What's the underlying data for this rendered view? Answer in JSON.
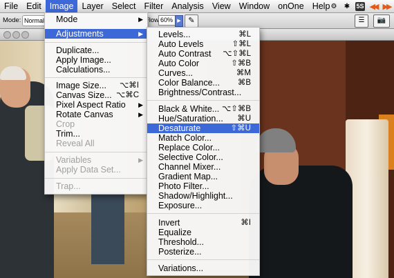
{
  "menubar": {
    "items": [
      "File",
      "Edit",
      "Image",
      "Layer",
      "Select",
      "Filter",
      "Analysis",
      "View",
      "Window",
      "onOne",
      "Help"
    ],
    "active_index": 2,
    "status": {
      "cs_badge": "5S"
    }
  },
  "options_bar": {
    "mode_label": "Mode:",
    "mode_value": "Normal",
    "flow_label": "Flow:",
    "flow_value": "60%"
  },
  "image_menu": {
    "items": [
      {
        "label": "Mode",
        "submenu": true
      },
      {
        "label": "Adjustments",
        "submenu": true,
        "highlight": true
      },
      {
        "label": "Duplicate..."
      },
      {
        "label": "Apply Image..."
      },
      {
        "label": "Calculations..."
      },
      {
        "label": "Image Size...",
        "shortcut": "⌥⌘I"
      },
      {
        "label": "Canvas Size...",
        "shortcut": "⌥⌘C"
      },
      {
        "label": "Pixel Aspect Ratio",
        "submenu": true
      },
      {
        "label": "Rotate Canvas",
        "submenu": true
      },
      {
        "label": "Crop",
        "disabled": true
      },
      {
        "label": "Trim..."
      },
      {
        "label": "Reveal All",
        "disabled": true
      },
      {
        "label": "Variables",
        "submenu": true,
        "disabled": true
      },
      {
        "label": "Apply Data Set...",
        "disabled": true
      },
      {
        "label": "Trap...",
        "disabled": true
      }
    ]
  },
  "adjustments_menu": {
    "items": [
      {
        "label": "Levels...",
        "shortcut": "⌘L"
      },
      {
        "label": "Auto Levels",
        "shortcut": "⇧⌘L"
      },
      {
        "label": "Auto Contrast",
        "shortcut": "⌥⇧⌘L"
      },
      {
        "label": "Auto Color",
        "shortcut": "⇧⌘B"
      },
      {
        "label": "Curves...",
        "shortcut": "⌘M"
      },
      {
        "label": "Color Balance...",
        "shortcut": "⌘B"
      },
      {
        "label": "Brightness/Contrast..."
      },
      {
        "label": "Black & White...",
        "shortcut": "⌥⇧⌘B"
      },
      {
        "label": "Hue/Saturation...",
        "shortcut": "⌘U"
      },
      {
        "label": "Desaturate",
        "shortcut": "⇧⌘U",
        "highlight": true
      },
      {
        "label": "Match Color..."
      },
      {
        "label": "Replace Color..."
      },
      {
        "label": "Selective Color..."
      },
      {
        "label": "Channel Mixer..."
      },
      {
        "label": "Gradient Map..."
      },
      {
        "label": "Photo Filter..."
      },
      {
        "label": "Shadow/Highlight..."
      },
      {
        "label": "Exposure..."
      },
      {
        "label": "Invert",
        "shortcut": "⌘I"
      },
      {
        "label": "Equalize"
      },
      {
        "label": "Threshold..."
      },
      {
        "label": "Posterize..."
      },
      {
        "label": "Variations..."
      }
    ]
  }
}
